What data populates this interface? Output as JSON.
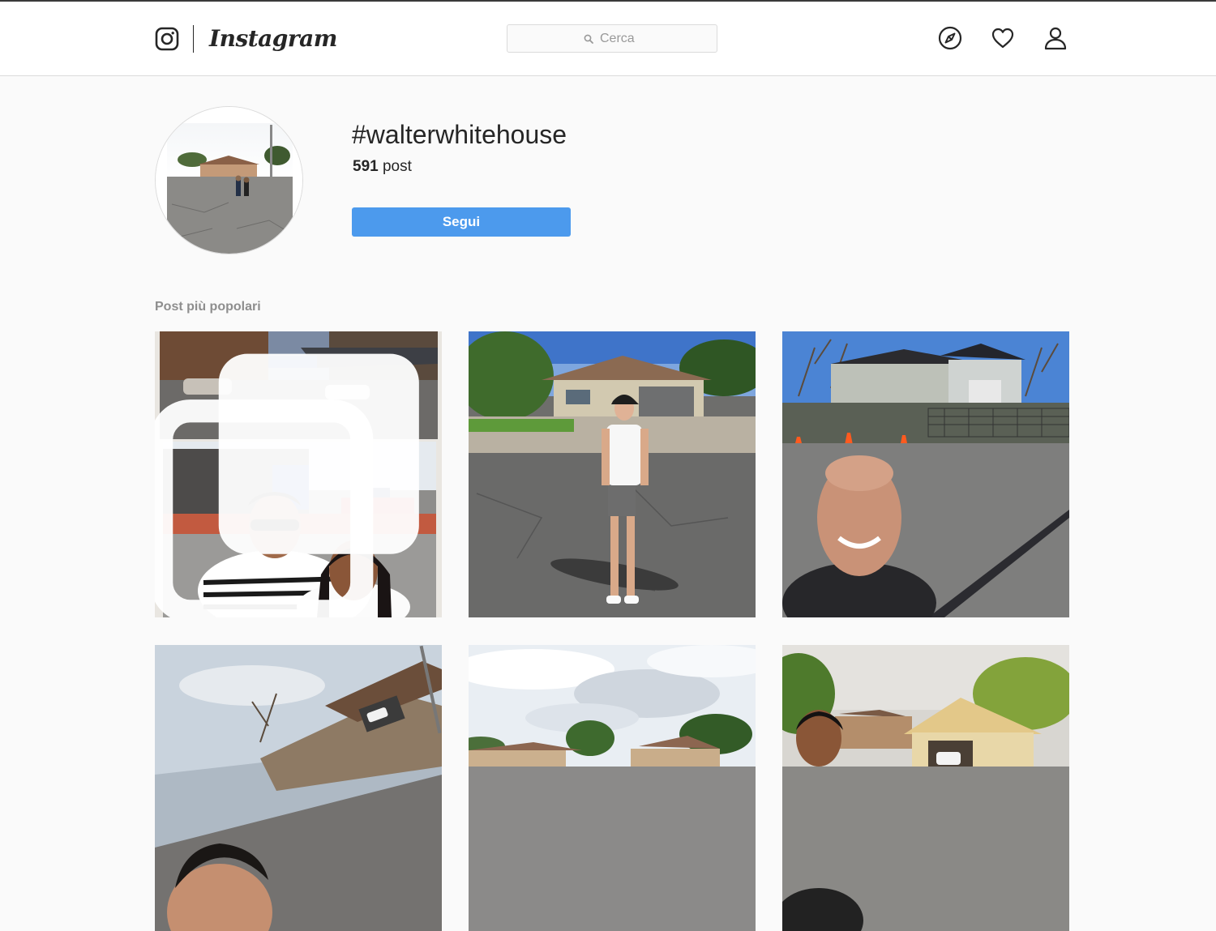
{
  "header": {
    "logo_text": "Instagram",
    "search": {
      "placeholder": "Cerca",
      "icon": "search-icon"
    },
    "nav_icons": [
      "compass-icon",
      "heart-icon",
      "profile-icon"
    ]
  },
  "hashtag": {
    "title": "#walterwhitehouse",
    "post_count": "591",
    "post_label": "post",
    "follow_label": "Segui"
  },
  "section": {
    "title": "Post più popolari"
  },
  "posts": [
    {
      "description": "two-photo collage of car wash and couple selfie",
      "carousel": true
    },
    {
      "description": "woman standing in street in front of house"
    },
    {
      "description": "man selfie in front of fenced house"
    },
    {
      "description": "man selfie tilted in front of house"
    },
    {
      "description": "cloudy sky over house with trees"
    },
    {
      "description": "man selfie near house with garage"
    }
  ],
  "colors": {
    "accent": "#4c9aed",
    "border": "#dbdbdb",
    "background": "#fafafa",
    "muted_text": "#8e8e8e"
  }
}
